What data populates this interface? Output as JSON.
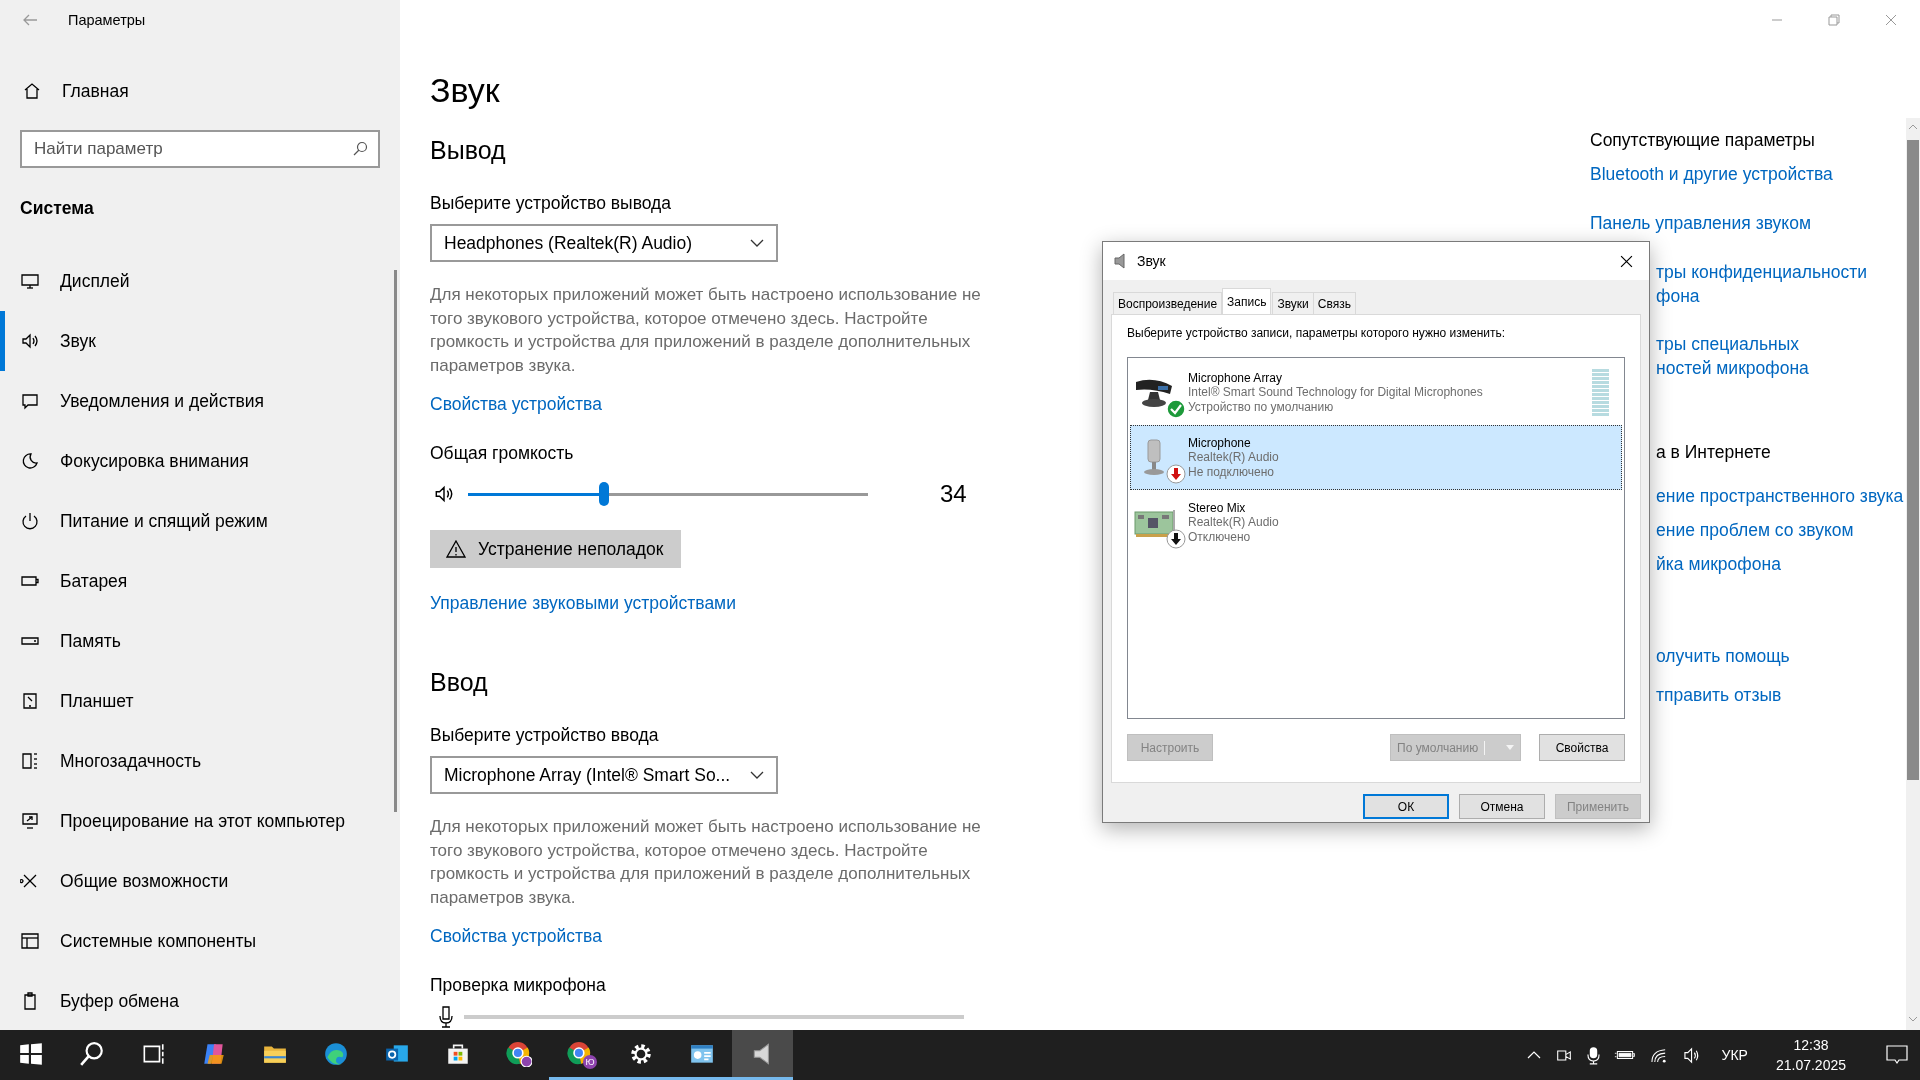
{
  "window": {
    "title": "Параметры"
  },
  "sidebar": {
    "home": "Главная",
    "search": {
      "placeholder": "Найти параметр"
    },
    "section": "Система",
    "items": [
      {
        "label": "Дисплей",
        "selected": false
      },
      {
        "label": "Звук",
        "selected": true
      },
      {
        "label": "Уведомления и действия",
        "selected": false
      },
      {
        "label": "Фокусировка внимания",
        "selected": false
      },
      {
        "label": "Питание и спящий режим",
        "selected": false
      },
      {
        "label": "Батарея",
        "selected": false
      },
      {
        "label": "Память",
        "selected": false
      },
      {
        "label": "Планшет",
        "selected": false
      },
      {
        "label": "Многозадачность",
        "selected": false
      },
      {
        "label": "Проецирование на этот компьютер",
        "selected": false
      },
      {
        "label": "Общие возможности",
        "selected": false
      },
      {
        "label": "Системные компоненты",
        "selected": false
      },
      {
        "label": "Буфер обмена",
        "selected": false
      }
    ]
  },
  "page": {
    "title": "Звук",
    "output": {
      "heading": "Вывод",
      "label": "Выберите устройство вывода",
      "device": "Headphones (Realtek(R) Audio)",
      "note": "Для некоторых приложений может быть настроено использование не того звукового устройства, которое отмечено здесь. Настройте громкость и устройства для приложений в разделе дополнительных параметров звука.",
      "properties_link": "Свойства устройства",
      "volume": {
        "label": "Общая громкость",
        "level": 0.34,
        "value": "34"
      },
      "troubleshoot": "Устранение неполадок",
      "manage_link": "Управление звуковыми устройствами"
    },
    "input": {
      "heading": "Ввод",
      "label": "Выберите устройство ввода",
      "device": "Microphone Array (Intel® Smart So...",
      "note": "Для некоторых приложений может быть настроено использование не того звукового устройства, которое отмечено здесь. Настройте громкость и устройства для приложений в разделе дополнительных параметров звука.",
      "properties_link": "Свойства устройства",
      "mic_test": {
        "label": "Проверка микрофона",
        "level": 0
      }
    }
  },
  "related_settings": {
    "title": "Сопутствующие параметры",
    "links": [
      "Bluetooth и другие устройства",
      "Панель управления звуком"
    ]
  },
  "right_column_cut": [
    {
      "links": [
        [
          "тры конфиденциальности",
          "фона"
        ],
        [
          "тры специальных",
          "ностей микрофона"
        ]
      ]
    },
    {
      "heading": "а в Интернете",
      "links": [
        [
          "ение пространственного звука"
        ],
        [
          "ение проблем со звуком"
        ],
        [
          "йка микрофона"
        ]
      ]
    },
    {
      "links": [
        [
          "олучить помощь"
        ],
        [
          "тправить отзыв"
        ]
      ]
    }
  ],
  "sound_dialog": {
    "title": "Звук",
    "tabs": [
      {
        "label": "Воспроизведение",
        "selected": false
      },
      {
        "label": "Запись",
        "selected": true
      },
      {
        "label": "Звуки",
        "selected": false
      },
      {
        "label": "Связь",
        "selected": false
      }
    ],
    "instruction": "Выберите устройство записи, параметры которого нужно изменить:",
    "devices": [
      {
        "name": "Microphone Array",
        "driver": "Intel® Smart Sound Technology for Digital Microphones",
        "status": "Устройство по умолчанию",
        "kind": "default",
        "selected": false
      },
      {
        "name": "Microphone",
        "driver": "Realtek(R) Audio",
        "status": "Не подключено",
        "kind": "unplugged",
        "selected": true
      },
      {
        "name": "Stereo Mix",
        "driver": "Realtek(R) Audio",
        "status": "Отключено",
        "kind": "disabled",
        "selected": false
      }
    ],
    "list_buttons": [
      {
        "label": "Настроить",
        "kind": "plain",
        "disabled": true
      },
      {
        "label": "По умолчанию",
        "kind": "split",
        "disabled": true
      },
      {
        "label": "Свойства",
        "kind": "plain",
        "disabled": false
      }
    ],
    "buttons": [
      {
        "label": "ОК",
        "disabled": false,
        "focused": true
      },
      {
        "label": "Отмена",
        "disabled": false,
        "focused": false
      },
      {
        "label": "Применить",
        "disabled": true,
        "focused": false
      }
    ]
  },
  "taskbar": {
    "buttons": [
      {
        "running": false,
        "selected": false
      },
      {
        "running": false,
        "selected": false
      },
      {
        "running": false,
        "selected": false
      },
      {
        "running": false,
        "selected": false
      },
      {
        "running": false,
        "selected": false
      },
      {
        "running": false,
        "selected": false
      },
      {
        "running": false,
        "selected": false
      },
      {
        "running": false,
        "selected": false
      },
      {
        "running": false,
        "selected": false
      },
      {
        "running": true,
        "selected": false,
        "badge": "Ю"
      },
      {
        "running": true,
        "selected": false
      },
      {
        "running": true,
        "selected": false
      },
      {
        "running": true,
        "selected": true
      }
    ],
    "tray": {
      "language": "УКР",
      "time": "12:38",
      "date": "21.07.2025"
    }
  }
}
